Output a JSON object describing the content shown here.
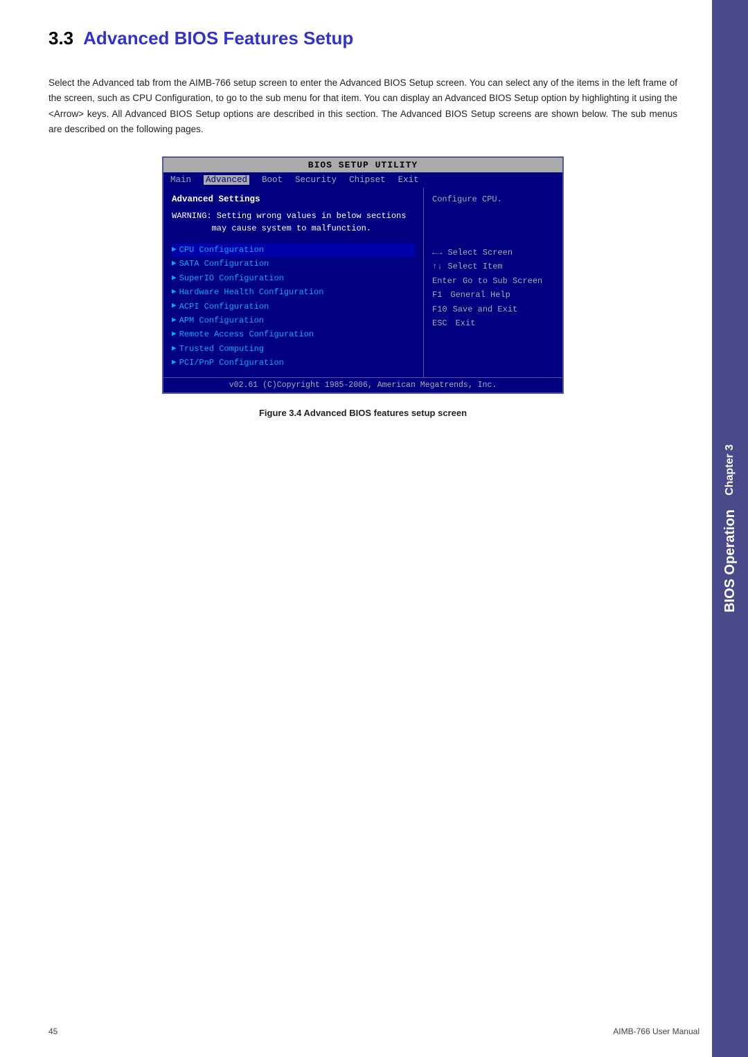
{
  "sidebar": {
    "chapter_label": "Chapter 3",
    "section_label": "BIOS Operation"
  },
  "section": {
    "number": "3.3",
    "title": "Advanced BIOS Features Setup",
    "body_text": "Select the Advanced tab from the AIMB-766 setup screen to enter the Advanced BIOS Setup screen. You can select any of the items in the left frame of the screen, such as CPU Configuration, to go to the sub menu for that item. You can display an Advanced BIOS Setup option by highlighting it using the <Arrow> keys. All Advanced BIOS Setup options are described in this section. The Advanced BIOS Setup screens are shown below. The sub menus are described on the following pages."
  },
  "bios": {
    "title_bar": "BIOS SETUP UTILITY",
    "menu_items": [
      "Main",
      "Advanced",
      "Boot",
      "Security",
      "Chipset",
      "Exit"
    ],
    "active_menu": "Advanced",
    "left_panel": {
      "title": "Advanced Settings",
      "warning_line1": "WARNING: Setting wrong values in below sections",
      "warning_line2": "        may cause system to malfunction.",
      "menu_entries": [
        "CPU Configuration",
        "SATA Configuration",
        "SuperIO Configuration",
        "Hardware Health Configuration",
        "ACPI Configuration",
        "APM Configuration",
        "Remote Access Configuration",
        "Trusted Computing",
        "PCI/PnP Configuration"
      ]
    },
    "right_panel": {
      "configure_text": "Configure CPU.",
      "help_keys": [
        {
          "key": "←→",
          "action": "Select Screen"
        },
        {
          "key": "↑↓",
          "action": "Select Item"
        },
        {
          "key": "Enter",
          "action": "Go to Sub Screen"
        },
        {
          "key": "F1",
          "action": "General Help"
        },
        {
          "key": "F10",
          "action": "Save and Exit"
        },
        {
          "key": "ESC",
          "action": "Exit"
        }
      ]
    },
    "footer": "v02.61 (C)Copyright 1985-2006, American Megatrends, Inc."
  },
  "figure_caption": "Figure 3.4 Advanced BIOS features setup screen",
  "page_footer": {
    "page_number": "45",
    "manual_name": "AIMB-766 User Manual"
  }
}
